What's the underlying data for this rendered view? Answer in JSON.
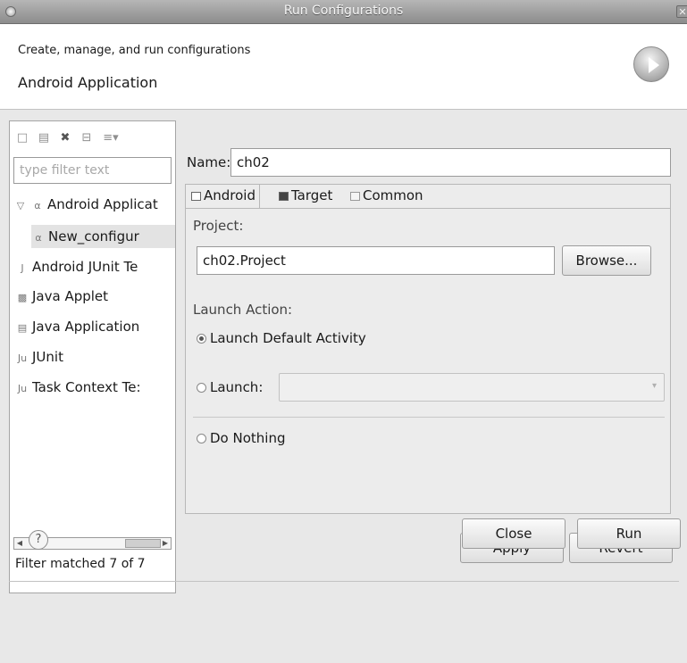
{
  "window": {
    "title": "Run Configurations"
  },
  "header": {
    "subtitle": "Create, manage, and run configurations",
    "section_title": "Android Application",
    "icon": "run-icon"
  },
  "left_panel": {
    "toolbar_icons": [
      "new-configuration-icon",
      "duplicate-icon",
      "delete-icon",
      "collapse-all-icon",
      "filter-menu-icon"
    ],
    "filter_placeholder": "type filter text",
    "tree": [
      {
        "label": "Android Applicat",
        "icon": "android-app-icon",
        "expanded": true
      },
      {
        "label": "New_configur",
        "icon": "config-icon",
        "selected": true
      },
      {
        "label": "Android JUnit Te",
        "icon": "android-junit-icon"
      },
      {
        "label": "Java Applet",
        "icon": "java-applet-icon"
      },
      {
        "label": "Java Application",
        "icon": "java-app-icon"
      },
      {
        "label": "JUnit",
        "icon": "junit-icon"
      },
      {
        "label": "Task Context Te:",
        "icon": "task-context-icon"
      }
    ],
    "filter_status": "Filter matched 7 of 7"
  },
  "config": {
    "name_label": "Name:",
    "name_value": "ch02",
    "tabs": [
      {
        "label": "Android",
        "icon": "android-tab-icon",
        "active": true
      },
      {
        "label": "Target",
        "icon": "target-tab-icon"
      },
      {
        "label": "Common",
        "icon": "common-tab-icon"
      }
    ],
    "project_label": "Project:",
    "project_value": "ch02.Project",
    "browse_label": "Browse...",
    "launch_action_label": "Launch Action:",
    "launch_options": [
      {
        "label": "Launch Default Activity",
        "checked": true
      },
      {
        "label": "Launch:",
        "checked": false
      },
      {
        "label": "Do Nothing",
        "checked": false
      }
    ],
    "launch_combo_value": ""
  },
  "actions": {
    "apply": "Apply",
    "revert": "Revert"
  },
  "footer": {
    "close": "Close",
    "run": "Run",
    "help_icon": "help-icon"
  }
}
